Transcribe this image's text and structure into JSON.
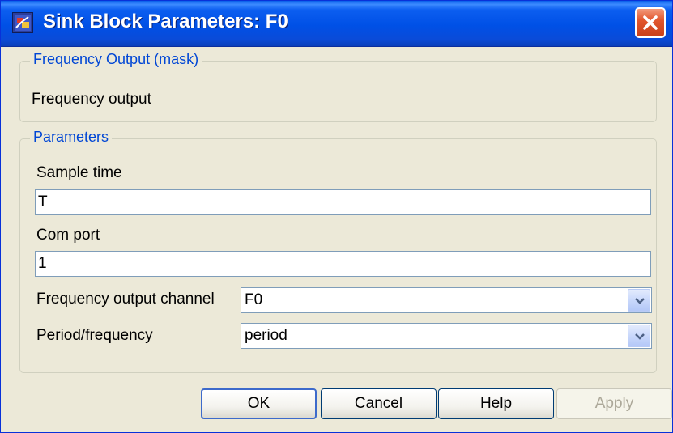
{
  "window": {
    "title": "Sink Block Parameters: F0"
  },
  "mask_group": {
    "legend": "Frequency Output (mask)",
    "description": "Frequency output"
  },
  "parameters_group": {
    "legend": "Parameters",
    "sample_time": {
      "label": "Sample time",
      "value": "T"
    },
    "com_port": {
      "label": "Com port",
      "value": "1"
    },
    "frequency_output_channel": {
      "label": "Frequency output channel",
      "value": "F0"
    },
    "period_frequency": {
      "label": "Period/frequency",
      "value": "period"
    }
  },
  "buttons": {
    "ok": "OK",
    "cancel": "Cancel",
    "help": "Help",
    "apply": "Apply"
  },
  "colors": {
    "titlebar": "#0050E6",
    "legend_text": "#0046D5",
    "dialog_bg": "#ECE9D8",
    "close_button": "#E2572E"
  },
  "icons": {
    "app": "simulink-block-icon",
    "close": "close-icon",
    "dropdown": "chevron-down-icon"
  }
}
